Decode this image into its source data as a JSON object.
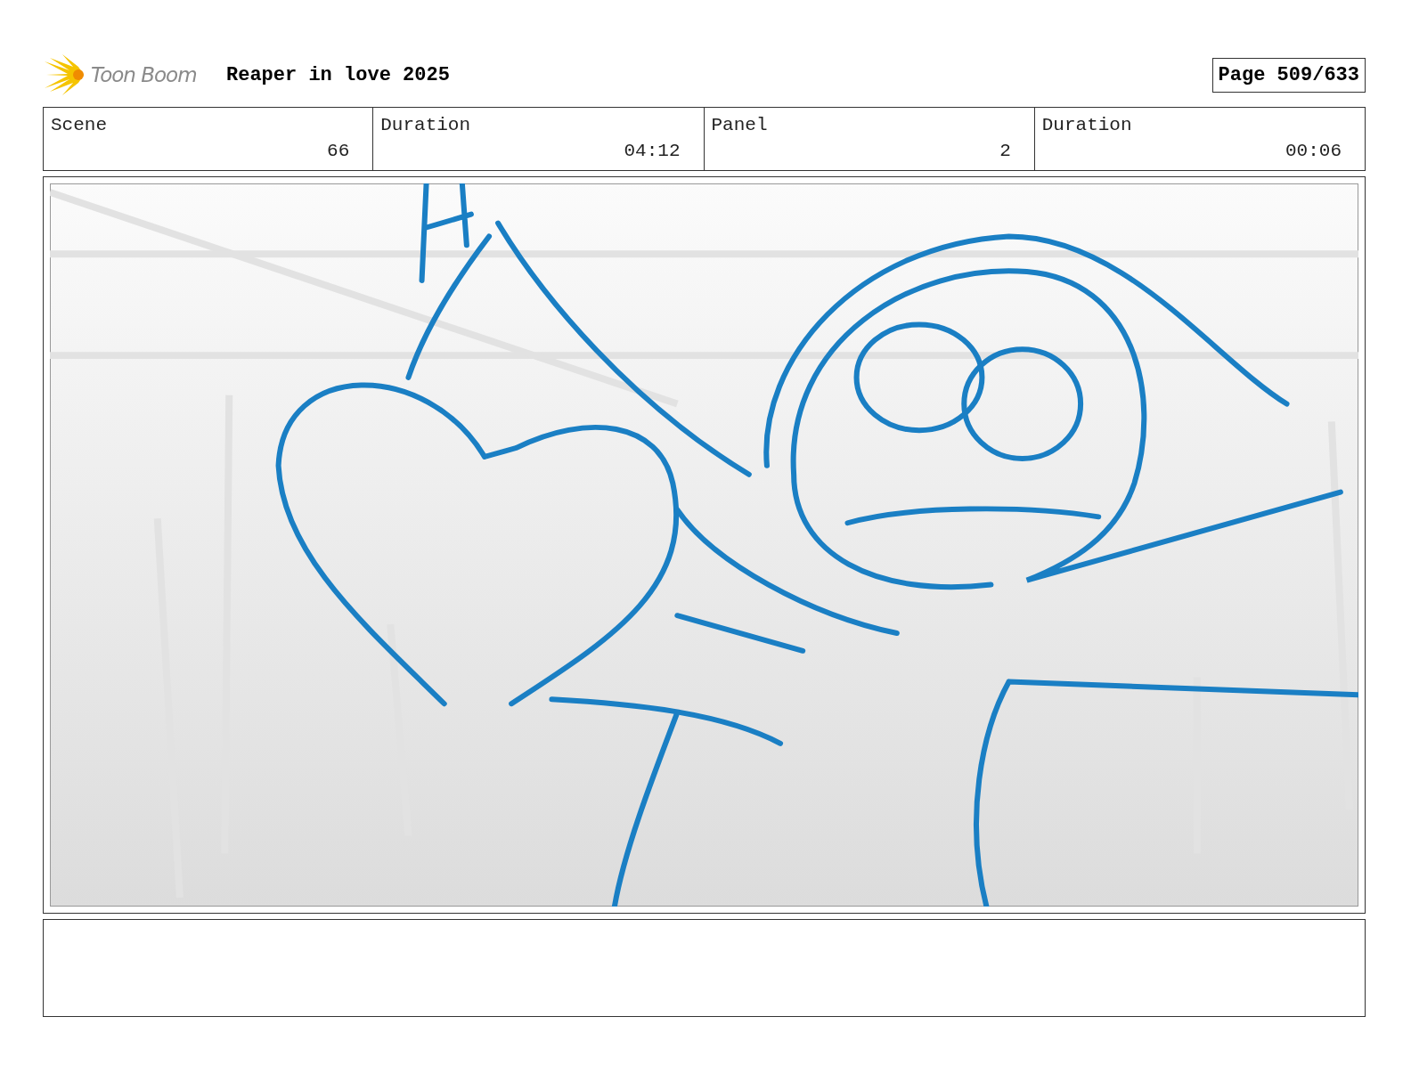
{
  "header": {
    "logo_text": "Toon Boom",
    "title": "Reaper in love 2025",
    "page": "Page 509/633"
  },
  "fields": [
    {
      "label": "Scene",
      "value": "66"
    },
    {
      "label": "Duration",
      "value": "04:12"
    },
    {
      "label": "Panel",
      "value": "2"
    },
    {
      "label": "Duration",
      "value": "00:06"
    }
  ]
}
